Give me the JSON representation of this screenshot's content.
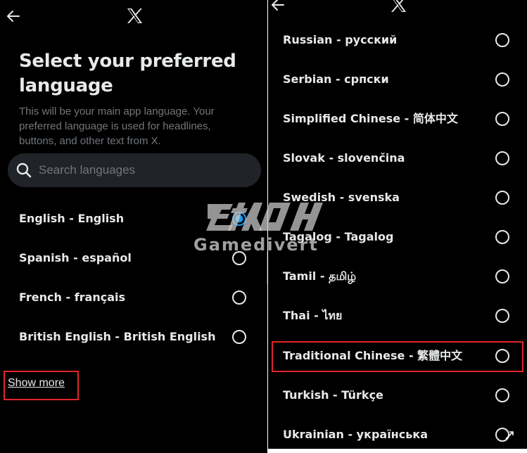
{
  "colors": {
    "background": "#000000",
    "text_primary": "#e7e9ea",
    "text_secondary": "#71767b",
    "search_bg": "#202327",
    "accent": "#1d9bf0",
    "highlight": "#e0262b"
  },
  "left_screen": {
    "nav": {
      "back_icon": "arrow-left-icon",
      "logo_icon": "x-logo-icon"
    },
    "title": "Select your preferred language",
    "subtitle": "This will be your main app language. Your preferred language is used for headlines, buttons, and other text from X.",
    "search": {
      "placeholder": "Search languages",
      "value": "",
      "icon": "search-icon"
    },
    "languages": [
      {
        "label": "English - English",
        "selected": true
      },
      {
        "label": "Spanish - español",
        "selected": false
      },
      {
        "label": "French - français",
        "selected": false
      },
      {
        "label": "British English - British English",
        "selected": false
      }
    ],
    "show_more_label": "Show more"
  },
  "right_screen": {
    "nav": {
      "back_icon": "arrow-left-icon",
      "logo_icon": "x-logo-icon"
    },
    "languages": [
      {
        "label": "Russian - русский",
        "selected": false
      },
      {
        "label": "Serbian - српски",
        "selected": false
      },
      {
        "label": "Simplified Chinese - 简体中文",
        "selected": false
      },
      {
        "label": "Slovak - slovenčina",
        "selected": false
      },
      {
        "label": "Swedish - svenska",
        "selected": false
      },
      {
        "label": "Tagalog - Tagalog",
        "selected": false
      },
      {
        "label": "Tamil - தமிழ்",
        "selected": false
      },
      {
        "label": "Thai - ไทย",
        "selected": false
      },
      {
        "label": "Traditional Chinese - 繁體中文",
        "selected": false
      },
      {
        "label": "Turkish - Türkçe",
        "selected": false
      },
      {
        "label": "Ukrainian - українська",
        "selected": false
      }
    ]
  },
  "watermark": {
    "text": "Gamedivert",
    "logo": "watermark-logo"
  }
}
